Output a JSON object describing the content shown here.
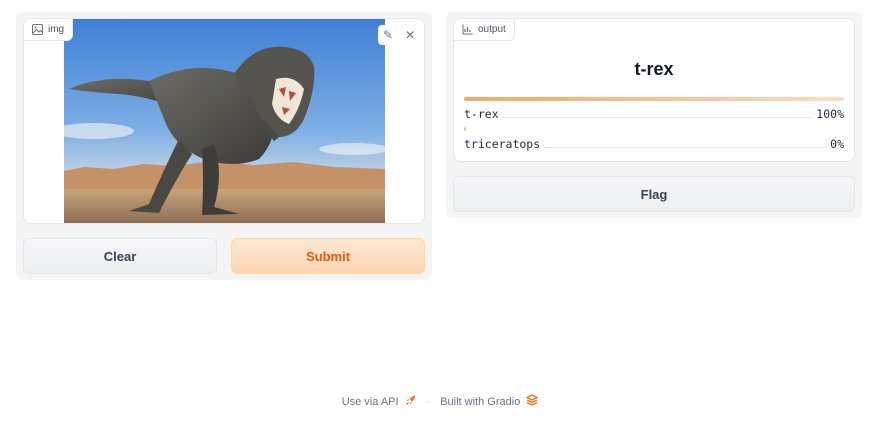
{
  "image_input": {
    "label": "img",
    "icon": "image-icon",
    "tools": [
      {
        "name": "edit",
        "glyph": "✎"
      },
      {
        "name": "close",
        "glyph": "✕"
      }
    ]
  },
  "buttons": {
    "clear_label": "Clear",
    "submit_label": "Submit",
    "flag_label": "Flag"
  },
  "output": {
    "label": "output",
    "icon": "chart-icon",
    "top_label": "t-rex",
    "confidences": [
      {
        "label": "t-rex",
        "value_text": "100%",
        "fraction": 1.0
      },
      {
        "label": "triceratops",
        "value_text": "0%",
        "fraction": 0.0
      }
    ]
  },
  "footer": {
    "api_text": "Use via API",
    "separator": "·",
    "built_text": "Built with Gradio"
  },
  "colors": {
    "accent": "#f97316",
    "submit_bg": "#fed7aa",
    "panel_bg": "#f5f5f6"
  }
}
